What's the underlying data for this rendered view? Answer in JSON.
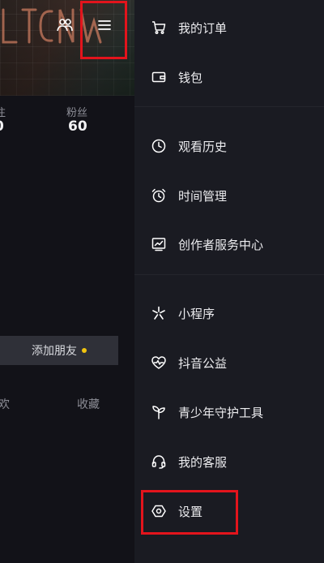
{
  "profile": {
    "stats": [
      {
        "label": "注",
        "value": "0"
      },
      {
        "label": "粉丝",
        "value": "60"
      }
    ],
    "add_friend": "添加朋友",
    "tabs": [
      "欢",
      "收藏"
    ]
  },
  "drawer": {
    "groups": [
      [
        {
          "label": "我的订单",
          "icon": "cart-icon"
        },
        {
          "label": "钱包",
          "icon": "wallet-icon"
        }
      ],
      [
        {
          "label": "观看历史",
          "icon": "clock-icon"
        },
        {
          "label": "时间管理",
          "icon": "alarm-icon"
        },
        {
          "label": "创作者服务中心",
          "icon": "chart-icon"
        }
      ],
      [
        {
          "label": "小程序",
          "icon": "sparkle-icon"
        },
        {
          "label": "抖音公益",
          "icon": "heart-pulse-icon"
        },
        {
          "label": "青少年守护工具",
          "icon": "sprout-icon"
        },
        {
          "label": "我的客服",
          "icon": "headset-icon"
        },
        {
          "label": "设置",
          "icon": "settings-icon"
        }
      ]
    ]
  },
  "colors": {
    "background": "#16171f",
    "drawer": "#1a1b22",
    "highlight": "#e3141c",
    "notification_dot": "#f1c40f"
  }
}
